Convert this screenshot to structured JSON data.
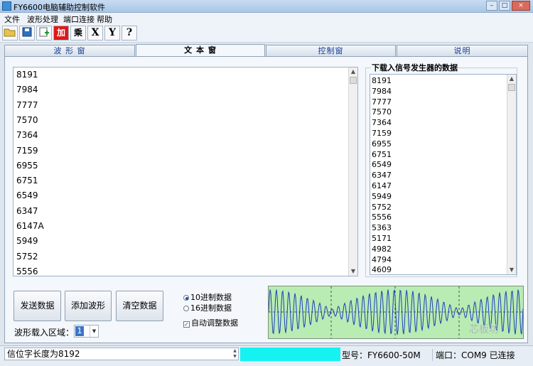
{
  "window": {
    "title": "FY6600电脑辅助控制软件"
  },
  "menu": [
    "文件",
    "波形处理",
    "端口连接",
    "帮助"
  ],
  "toolbar": {
    "multiply_label": "乘",
    "x_label": "X",
    "y_label": "Y",
    "help_label": "?"
  },
  "tabs": [
    "波 形 窗",
    "文 本 窗",
    "控制窗",
    "说明"
  ],
  "text_window": {
    "lines": [
      "8191",
      "7984",
      "7777",
      "7570",
      "7364",
      "7159",
      "6955",
      "6751",
      "6549",
      "6347",
      "6147A",
      "5949",
      "5752",
      "5556"
    ]
  },
  "download_group": {
    "title": "下载入信号发生器的数据",
    "lines": [
      "8191",
      "7984",
      "7777",
      "7570",
      "7364",
      "7159",
      "6955",
      "6751",
      "6549",
      "6347",
      "6147",
      "5949",
      "5752",
      "5556",
      "5363",
      "5171",
      "4982",
      "4794",
      "4609"
    ]
  },
  "buttons": {
    "send": "发送数据",
    "add_wave": "添加波形",
    "clear": "清空数据"
  },
  "format": {
    "decimal": "10进制数据",
    "hex": "16进制数据",
    "auto_adjust": "自动调整数据"
  },
  "load": {
    "label": "波形载入区域：",
    "value": "1"
  },
  "status": {
    "message": "信位字长度为8192",
    "model": "型号：FY6600-50M",
    "port": "端口：COM9 已连接"
  },
  "watermark": "芯板坊",
  "colors": {
    "wave_bg": "#b9ecb3",
    "wave_line": "#1d3fb8",
    "status_cyan": "#14f2f2"
  }
}
